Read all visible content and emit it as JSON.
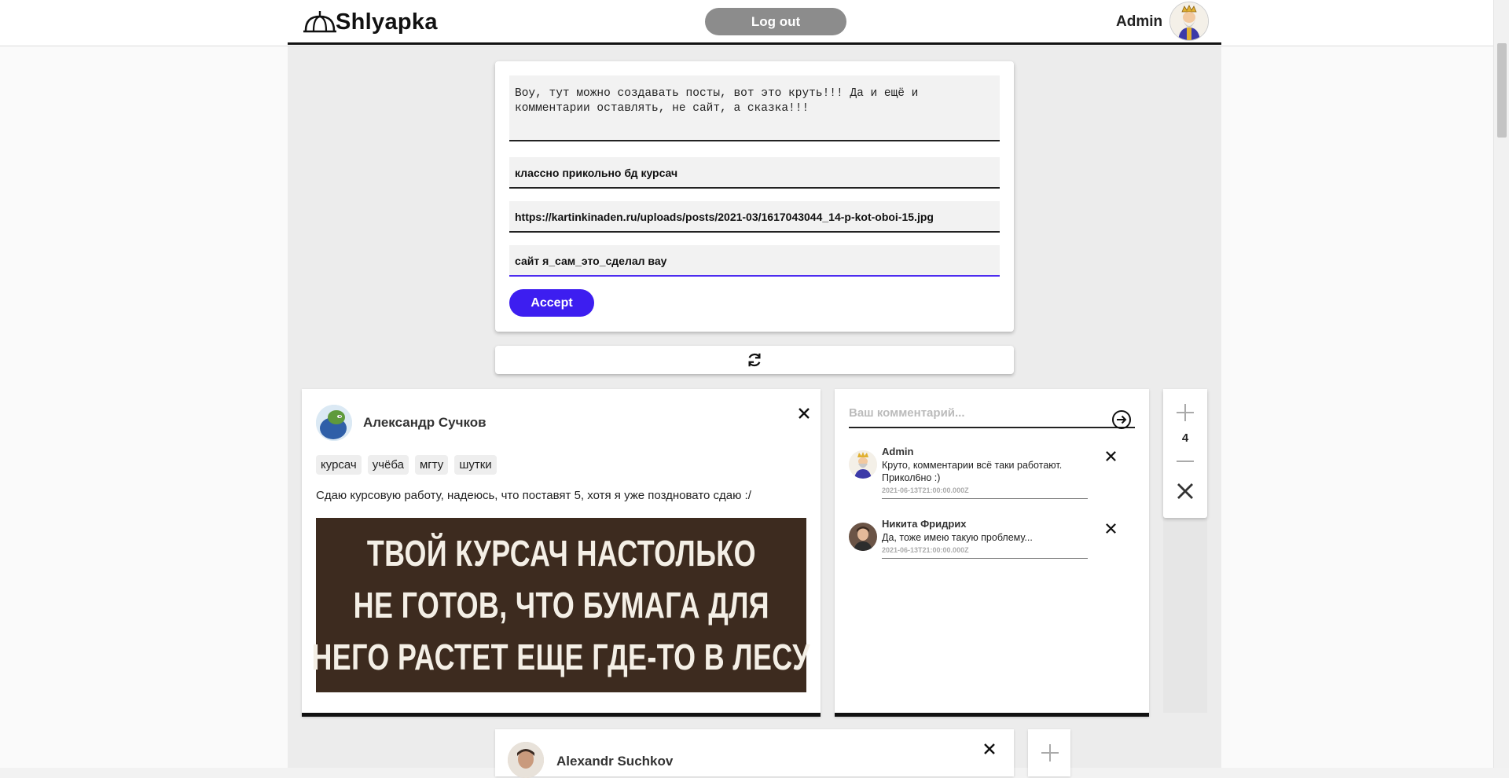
{
  "header": {
    "logo_text": "Shlyapka",
    "logout_label": "Log out",
    "user_name": "Admin"
  },
  "create_post": {
    "text_value": "Воу, тут можно создавать посты, вот это круть!!! Да и ещё и комментарии оставлять, не сайт, а сказка!!!",
    "tags_value": "классно прикольно бд курсач",
    "image_url_value": "https://kartinkinaden.ru/uploads/posts/2021-03/1617043044_14-p-kot-oboi-15.jpg",
    "extra_value": "сайт я_сам_это_сделал вау",
    "accept_label": "Accept"
  },
  "post": {
    "author": "Александр Сучков",
    "tags": [
      "курсач",
      "учёба",
      "мгту",
      "шутки"
    ],
    "text": "Сдаю курсовую работу, надеюсь, что поставят 5, хотя я уже поздновато сдаю :/",
    "image_lines": [
      "ТВОЙ КУРСАЧ НАСТОЛЬКО",
      "НЕ ГОТОВ, ЧТО БУМАГА ДЛЯ",
      "НЕГО РАСТЕТ ЕЩЕ ГДЕ-ТО В ЛЕСУ"
    ],
    "rating": "4"
  },
  "comments": {
    "placeholder": "Ваш комментарий...",
    "items": [
      {
        "author": "Admin",
        "text": "Круто, комментарии всё таки работают. Прикол6но :)",
        "date": "2021-06-13T21:00:00.000Z"
      },
      {
        "author": "Никита Фридрих",
        "text": "Да, тоже имею такую проблему...",
        "date": "2021-06-13T21:00:00.000Z"
      }
    ]
  },
  "post2": {
    "author": "Alexandr Suchkov"
  },
  "colors": {
    "accent": "#3d1ef0",
    "logout_bg": "#8c8c8c",
    "meme_bg": "#3d2b1f"
  }
}
